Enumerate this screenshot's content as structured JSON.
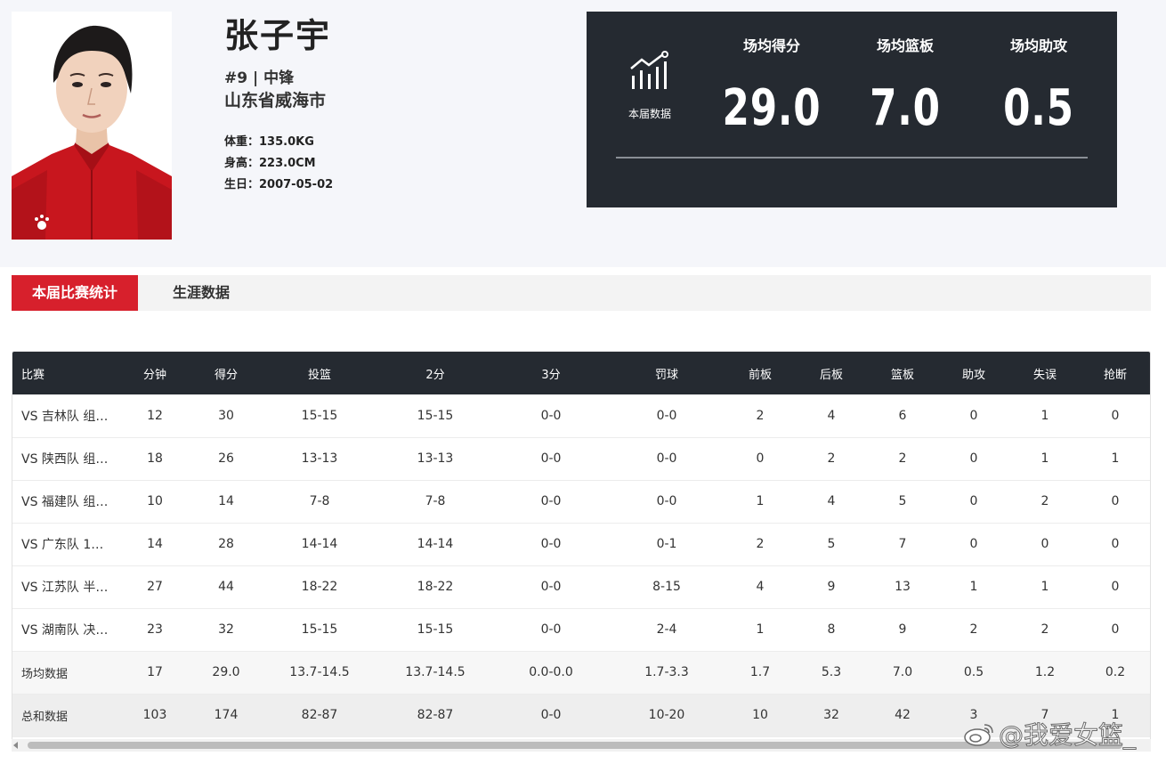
{
  "player": {
    "name": "张子宇",
    "number_position": "#9 | 中锋",
    "hometown": "山东省威海市",
    "weight": "体重：135.0KG",
    "height": "身高：223.0CM",
    "birthday": "生日：2007-05-02"
  },
  "season_card": {
    "icon": "chart-growth-icon",
    "label": "本届数据",
    "stats": [
      {
        "label": "场均得分",
        "value": "29.0"
      },
      {
        "label": "场均篮板",
        "value": "7.0"
      },
      {
        "label": "场均助攻",
        "value": "0.5"
      }
    ]
  },
  "tabs": [
    {
      "label": "本届比赛统计",
      "active": true
    },
    {
      "label": "生涯数据",
      "active": false
    }
  ],
  "table": {
    "headers": [
      "比赛",
      "分钟",
      "得分",
      "投篮",
      "2分",
      "3分",
      "罚球",
      "前板",
      "后板",
      "篮板",
      "助攻",
      "失误",
      "抢断"
    ],
    "rows": [
      [
        "VS 吉林队 组…",
        "12",
        "30",
        "15-15",
        "15-15",
        "0-0",
        "0-0",
        "2",
        "4",
        "6",
        "0",
        "1",
        "0"
      ],
      [
        "VS 陕西队 组…",
        "18",
        "26",
        "13-13",
        "13-13",
        "0-0",
        "0-0",
        "0",
        "2",
        "2",
        "0",
        "1",
        "1"
      ],
      [
        "VS 福建队 组…",
        "10",
        "14",
        "7-8",
        "7-8",
        "0-0",
        "0-0",
        "1",
        "4",
        "5",
        "0",
        "2",
        "0"
      ],
      [
        "VS 广东队 1…",
        "14",
        "28",
        "14-14",
        "14-14",
        "0-0",
        "0-1",
        "2",
        "5",
        "7",
        "0",
        "0",
        "0"
      ],
      [
        "VS 江苏队 半…",
        "27",
        "44",
        "18-22",
        "18-22",
        "0-0",
        "8-15",
        "4",
        "9",
        "13",
        "1",
        "1",
        "0"
      ],
      [
        "VS 湖南队 决…",
        "23",
        "32",
        "15-15",
        "15-15",
        "0-0",
        "2-4",
        "1",
        "8",
        "9",
        "2",
        "2",
        "0"
      ]
    ],
    "average": [
      "场均数据",
      "17",
      "29.0",
      "13.7-14.5",
      "13.7-14.5",
      "0.0-0.0",
      "1.7-3.3",
      "1.7",
      "5.3",
      "7.0",
      "0.5",
      "1.2",
      "0.2"
    ],
    "total": [
      "总和数据",
      "103",
      "174",
      "82-87",
      "82-87",
      "0-0",
      "10-20",
      "10",
      "32",
      "42",
      "3",
      "7",
      "1"
    ]
  },
  "watermark": {
    "text": "@我爱女篮_",
    "icon": "weibo-logo-icon"
  },
  "colors": {
    "accent_red": "#d7202c",
    "dark_panel": "#252a31",
    "top_bg": "#f5f6fa"
  }
}
